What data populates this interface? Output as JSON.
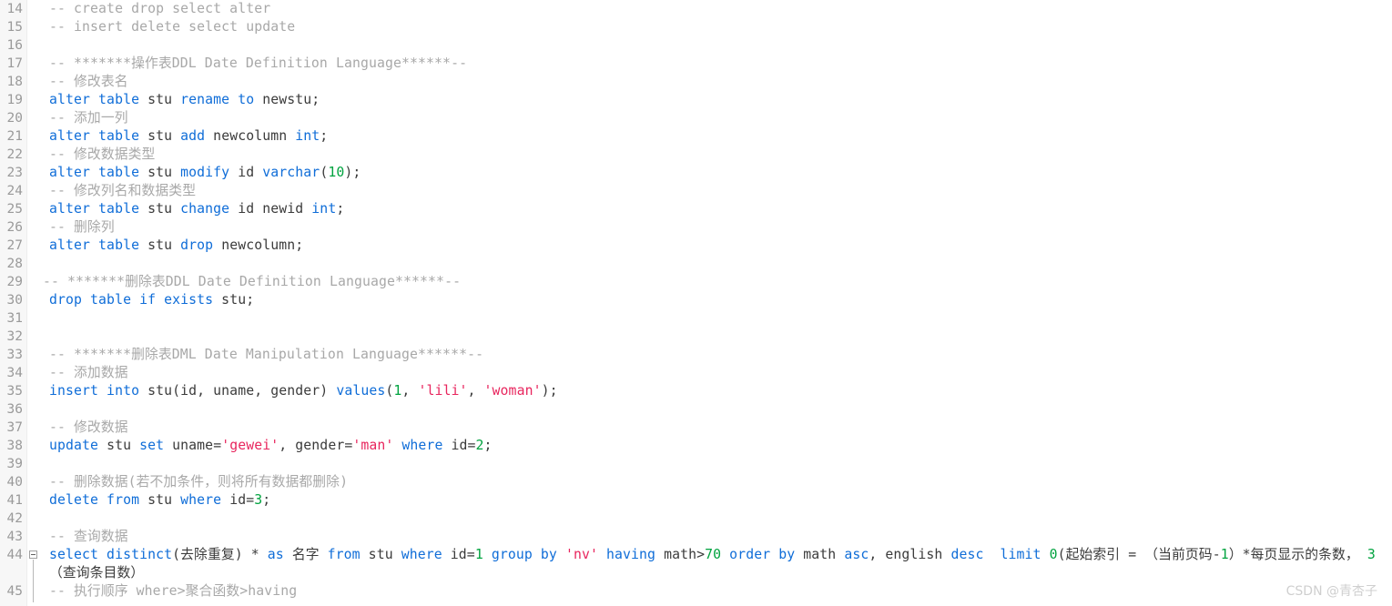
{
  "editor": {
    "colors": {
      "background": "#ffffff",
      "gutter_background": "#f7f7f7",
      "line_number": "#9a9a9a",
      "keyword": "#0f6dd8",
      "number": "#00a33f",
      "string": "#e8265e",
      "comment": "#a8a8a8",
      "plain": "#3b3b3b",
      "watermark": "#cfcfcf"
    },
    "first_line_number": 14,
    "lines": [
      {
        "n": "14",
        "tokens": [
          {
            "t": "cmt",
            "v": "-- create drop select alter"
          }
        ]
      },
      {
        "n": "15",
        "tokens": [
          {
            "t": "cmt",
            "v": "-- insert delete select update"
          }
        ]
      },
      {
        "n": "16",
        "tokens": []
      },
      {
        "n": "17",
        "tokens": [
          {
            "t": "cmt",
            "v": "-- *******操作表DDL Date Definition Language******--"
          }
        ]
      },
      {
        "n": "18",
        "tokens": [
          {
            "t": "cmt",
            "v": "-- 修改表名"
          }
        ]
      },
      {
        "n": "19",
        "tokens": [
          {
            "t": "kw",
            "v": "alter table"
          },
          {
            "t": "pl",
            "v": " stu "
          },
          {
            "t": "kw",
            "v": "rename to"
          },
          {
            "t": "pl",
            "v": " newstu;"
          }
        ]
      },
      {
        "n": "20",
        "tokens": [
          {
            "t": "cmt",
            "v": "-- 添加一列"
          }
        ]
      },
      {
        "n": "21",
        "tokens": [
          {
            "t": "kw",
            "v": "alter table"
          },
          {
            "t": "pl",
            "v": " stu "
          },
          {
            "t": "kw",
            "v": "add"
          },
          {
            "t": "pl",
            "v": " newcolumn "
          },
          {
            "t": "kw",
            "v": "int"
          },
          {
            "t": "pl",
            "v": ";"
          }
        ]
      },
      {
        "n": "22",
        "tokens": [
          {
            "t": "cmt",
            "v": "-- 修改数据类型"
          }
        ]
      },
      {
        "n": "23",
        "tokens": [
          {
            "t": "kw",
            "v": "alter table"
          },
          {
            "t": "pl",
            "v": " stu "
          },
          {
            "t": "kw",
            "v": "modify"
          },
          {
            "t": "pl",
            "v": " id "
          },
          {
            "t": "kw",
            "v": "varchar"
          },
          {
            "t": "pl",
            "v": "("
          },
          {
            "t": "num",
            "v": "10"
          },
          {
            "t": "pl",
            "v": ");"
          }
        ]
      },
      {
        "n": "24",
        "tokens": [
          {
            "t": "cmt",
            "v": "-- 修改列名和数据类型"
          }
        ]
      },
      {
        "n": "25",
        "tokens": [
          {
            "t": "kw",
            "v": "alter table"
          },
          {
            "t": "pl",
            "v": " stu "
          },
          {
            "t": "kw",
            "v": "change"
          },
          {
            "t": "pl",
            "v": " id newid "
          },
          {
            "t": "kw",
            "v": "int"
          },
          {
            "t": "pl",
            "v": ";"
          }
        ]
      },
      {
        "n": "26",
        "tokens": [
          {
            "t": "cmt",
            "v": "-- 删除列"
          }
        ]
      },
      {
        "n": "27",
        "tokens": [
          {
            "t": "kw",
            "v": "alter table"
          },
          {
            "t": "pl",
            "v": " stu "
          },
          {
            "t": "kw",
            "v": "drop"
          },
          {
            "t": "pl",
            "v": " newcolumn;"
          }
        ]
      },
      {
        "n": "28",
        "tokens": []
      },
      {
        "n": "29",
        "outdent": true,
        "tokens": [
          {
            "t": "cmt",
            "v": "-- *******删除表DDL Date Definition Language******--"
          }
        ]
      },
      {
        "n": "30",
        "tokens": [
          {
            "t": "kw",
            "v": "drop table if exists"
          },
          {
            "t": "pl",
            "v": " stu;"
          }
        ]
      },
      {
        "n": "31",
        "tokens": []
      },
      {
        "n": "32",
        "tokens": []
      },
      {
        "n": "33",
        "tokens": [
          {
            "t": "cmt",
            "v": "-- *******删除表DML Date Manipulation Language******--"
          }
        ]
      },
      {
        "n": "34",
        "tokens": [
          {
            "t": "cmt",
            "v": "-- 添加数据"
          }
        ]
      },
      {
        "n": "35",
        "tokens": [
          {
            "t": "kw",
            "v": "insert into"
          },
          {
            "t": "pl",
            "v": " stu(id, uname, gender) "
          },
          {
            "t": "kw",
            "v": "values"
          },
          {
            "t": "pl",
            "v": "("
          },
          {
            "t": "num",
            "v": "1"
          },
          {
            "t": "pl",
            "v": ", "
          },
          {
            "t": "str",
            "v": "'lili'"
          },
          {
            "t": "pl",
            "v": ", "
          },
          {
            "t": "str",
            "v": "'woman'"
          },
          {
            "t": "pl",
            "v": ");"
          }
        ]
      },
      {
        "n": "36",
        "tokens": []
      },
      {
        "n": "37",
        "tokens": [
          {
            "t": "cmt",
            "v": "-- 修改数据"
          }
        ]
      },
      {
        "n": "38",
        "tokens": [
          {
            "t": "kw",
            "v": "update"
          },
          {
            "t": "pl",
            "v": " stu "
          },
          {
            "t": "kw",
            "v": "set"
          },
          {
            "t": "pl",
            "v": " uname="
          },
          {
            "t": "str",
            "v": "'gewei'"
          },
          {
            "t": "pl",
            "v": ", gender="
          },
          {
            "t": "str",
            "v": "'man'"
          },
          {
            "t": "pl",
            "v": " "
          },
          {
            "t": "kw",
            "v": "where"
          },
          {
            "t": "pl",
            "v": " id="
          },
          {
            "t": "num",
            "v": "2"
          },
          {
            "t": "pl",
            "v": ";"
          }
        ]
      },
      {
        "n": "39",
        "tokens": []
      },
      {
        "n": "40",
        "tokens": [
          {
            "t": "cmt",
            "v": "-- 删除数据(若不加条件，则将所有数据都删除)"
          }
        ]
      },
      {
        "n": "41",
        "tokens": [
          {
            "t": "kw",
            "v": "delete from"
          },
          {
            "t": "pl",
            "v": " stu "
          },
          {
            "t": "kw",
            "v": "where"
          },
          {
            "t": "pl",
            "v": " id="
          },
          {
            "t": "num",
            "v": "3"
          },
          {
            "t": "pl",
            "v": ";"
          }
        ]
      },
      {
        "n": "42",
        "tokens": []
      },
      {
        "n": "43",
        "tokens": [
          {
            "t": "cmt",
            "v": "-- 查询数据"
          }
        ]
      },
      {
        "n": "44",
        "fold": true,
        "wrap": true,
        "tokens": [
          {
            "t": "kw",
            "v": "select distinct"
          },
          {
            "t": "pl",
            "v": "(去除重复) * "
          },
          {
            "t": "kw",
            "v": "as"
          },
          {
            "t": "pl",
            "v": " 名字 "
          },
          {
            "t": "kw",
            "v": "from"
          },
          {
            "t": "pl",
            "v": " stu "
          },
          {
            "t": "kw",
            "v": "where"
          },
          {
            "t": "pl",
            "v": " id="
          },
          {
            "t": "num",
            "v": "1"
          },
          {
            "t": "pl",
            "v": " "
          },
          {
            "t": "kw",
            "v": "group by"
          },
          {
            "t": "pl",
            "v": " "
          },
          {
            "t": "str",
            "v": "'nv'"
          },
          {
            "t": "pl",
            "v": " "
          },
          {
            "t": "kw",
            "v": "having"
          },
          {
            "t": "pl",
            "v": " math>"
          },
          {
            "t": "num",
            "v": "70"
          },
          {
            "t": "pl",
            "v": " "
          },
          {
            "t": "kw",
            "v": "order by"
          },
          {
            "t": "pl",
            "v": " math "
          },
          {
            "t": "kw",
            "v": "asc"
          },
          {
            "t": "pl",
            "v": ", english "
          },
          {
            "t": "kw",
            "v": "desc"
          },
          {
            "t": "pl",
            "v": "  "
          },
          {
            "t": "kw",
            "v": "limit"
          },
          {
            "t": "pl",
            "v": " "
          },
          {
            "t": "num",
            "v": "0"
          },
          {
            "t": "pl",
            "v": "(起始索引 = （当前页码-"
          },
          {
            "t": "num",
            "v": "1"
          },
          {
            "t": "pl",
            "v": "）*每页显示的条数， "
          },
          {
            "t": "num",
            "v": "3"
          },
          {
            "t": "pl",
            "v": "（查询条目数）"
          }
        ]
      },
      {
        "n": "45",
        "fold_guide": true,
        "tokens": [
          {
            "t": "cmt",
            "v": "-- 执行顺序 where>聚合函数>having"
          }
        ]
      }
    ]
  },
  "watermark": {
    "text": "CSDN @青杏子"
  }
}
